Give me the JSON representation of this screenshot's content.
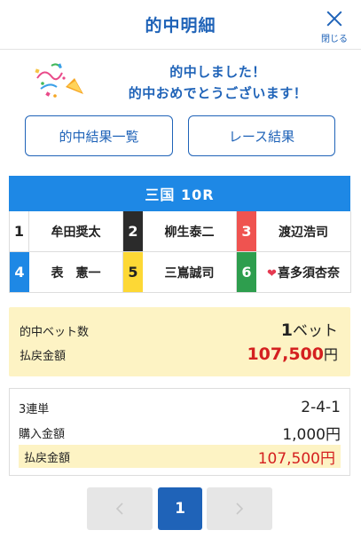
{
  "header": {
    "title": "的中明細",
    "close_label": "閉じる"
  },
  "congrats": {
    "line1": "的中しました！",
    "line2": "的中おめでとうございます！"
  },
  "buttons": {
    "results_list": "的中結果一覧",
    "race_results": "レース結果"
  },
  "race": {
    "title": "三国 10R",
    "entries": [
      {
        "num": "1",
        "name": "牟田奨太",
        "color": "#ffffff"
      },
      {
        "num": "2",
        "name": "柳生泰二",
        "color": "#2b2b2b"
      },
      {
        "num": "3",
        "name": "渡辺浩司",
        "color": "#ef5350"
      },
      {
        "num": "4",
        "name": "表　憲一",
        "color": "#1e88e5"
      },
      {
        "num": "5",
        "name": "三嶌誠司",
        "color": "#fdd835"
      },
      {
        "num": "6",
        "name": "喜多須杏奈",
        "color": "#2e9e4e",
        "icon": "heart-icon"
      }
    ]
  },
  "summary": {
    "hit_bets_label": "的中ベット数",
    "hit_bets_value": "1",
    "hit_bets_unit": "ベット",
    "payout_label": "払戻金額",
    "payout_value": "107,500",
    "payout_unit": "円"
  },
  "detail": {
    "bet_type": "3連単",
    "combination": "2-4-1",
    "purchase_label": "購入金額",
    "purchase_value": "1,000円",
    "payout_label": "払戻金額",
    "payout_value": "107,500円"
  },
  "pager": {
    "prev_icon": "chevron-left-icon",
    "current": "1",
    "next_icon": "chevron-right-icon"
  }
}
